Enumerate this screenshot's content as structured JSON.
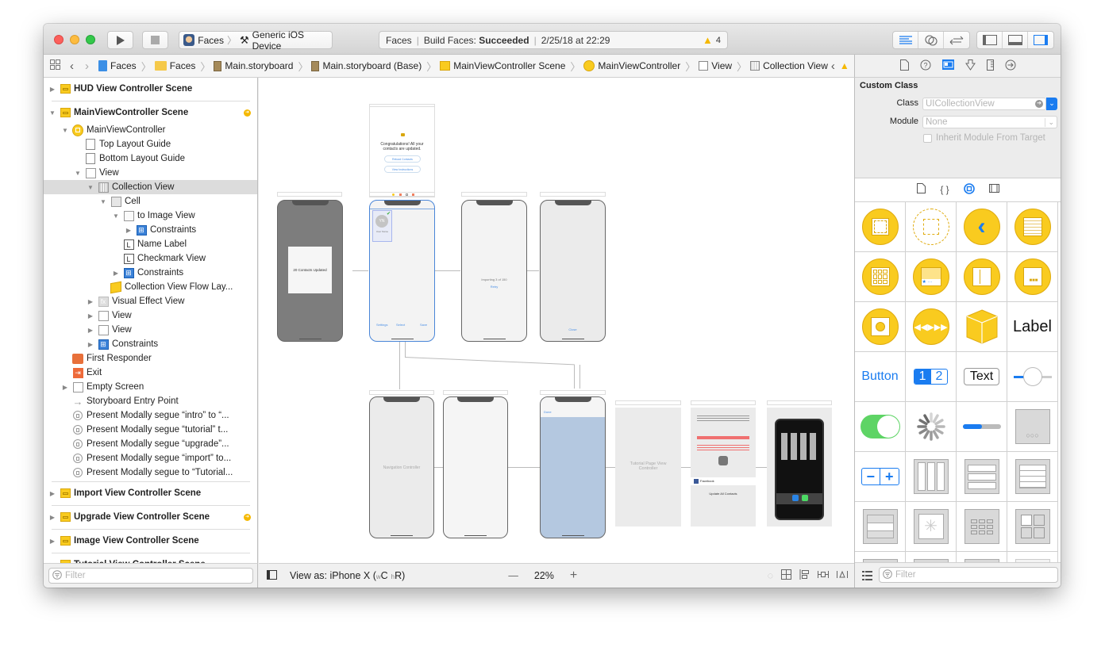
{
  "toolbar": {
    "scheme_target": "Faces",
    "scheme_device": "Generic iOS Device",
    "activity_project": "Faces",
    "activity_status_prefix": "Build Faces: ",
    "activity_status": "Succeeded",
    "activity_time": "2/25/18 at 22:29",
    "warnings_count": "4"
  },
  "jumpbar": {
    "crumbs": [
      "Faces",
      "Faces",
      "Main.storyboard",
      "Main.storyboard (Base)",
      "MainViewController Scene",
      "MainViewController",
      "View",
      "Collection View"
    ]
  },
  "outline": {
    "rows": [
      {
        "label": "HUD View Controller Scene",
        "icon": "scene-icon"
      },
      {
        "label": "MainViewController Scene",
        "icon": "scene-icon"
      },
      {
        "label": "MainViewController",
        "icon": "view-controller-icon"
      },
      {
        "label": "Top Layout Guide",
        "icon": "layout-guide-icon"
      },
      {
        "label": "Bottom Layout Guide",
        "icon": "layout-guide-icon"
      },
      {
        "label": "View",
        "icon": "view-icon"
      },
      {
        "label": "Collection View",
        "icon": "collection-view-icon"
      },
      {
        "label": "Cell",
        "icon": "cell-icon"
      },
      {
        "label": "to Image View",
        "icon": "image-view-icon"
      },
      {
        "label": "Constraints",
        "icon": "constraints-icon"
      },
      {
        "label": "Name Label",
        "icon": "label-icon"
      },
      {
        "label": "Checkmark View",
        "icon": "label-icon"
      },
      {
        "label": "Constraints",
        "icon": "constraints-icon"
      },
      {
        "label": "Collection View Flow Lay...",
        "icon": "flow-layout-icon"
      },
      {
        "label": "Visual Effect View",
        "icon": "visual-effect-icon"
      },
      {
        "label": "View",
        "icon": "view-icon"
      },
      {
        "label": "View",
        "icon": "view-icon"
      },
      {
        "label": "Constraints",
        "icon": "constraints-icon"
      },
      {
        "label": "First Responder",
        "icon": "first-responder-icon"
      },
      {
        "label": "Exit",
        "icon": "exit-icon"
      },
      {
        "label": "Empty Screen",
        "icon": "view-icon"
      },
      {
        "label": "Storyboard Entry Point",
        "icon": "entry-arrow-icon"
      },
      {
        "label": "Present Modally segue “intro” to “...",
        "icon": "segue-icon"
      },
      {
        "label": "Present Modally segue “tutorial” t...",
        "icon": "segue-icon"
      },
      {
        "label": "Present Modally segue “upgrade”...",
        "icon": "segue-icon"
      },
      {
        "label": "Present Modally segue “import” to...",
        "icon": "segue-icon"
      },
      {
        "label": "Present Modally segue to “Tutorial...",
        "icon": "segue-icon"
      },
      {
        "label": "Import View Controller Scene",
        "icon": "scene-icon"
      },
      {
        "label": "Upgrade View Controller Scene",
        "icon": "scene-icon"
      },
      {
        "label": "Image View Controller Scene",
        "icon": "scene-icon"
      },
      {
        "label": "Tutorial View Controller Scene",
        "icon": "scene-icon"
      }
    ],
    "filter_placeholder": "Filter"
  },
  "canvas": {
    "scenes": {
      "empty_screen_text": "Congratulations! All your contacts are updated.",
      "empty_btn1": "Reload Contacts",
      "empty_btn2": "View Instructions",
      "hud_text": "20 Contacts Updated",
      "cell_initials": "YN",
      "cell_name": "User Name",
      "main_toolbar": [
        "Settings",
        "Select",
        "Save"
      ],
      "import_text": "Importing 3 of 150",
      "import_link": "Retry",
      "upgrade_link": "Close",
      "nav_controller": "Navigation Controller",
      "tutorial_done": "Done",
      "tutorial_page": "Tutorial Page View Controller",
      "facebook_row": "Facebook",
      "update_all": "Update All Contacts"
    },
    "view_as_label": "View as: iPhone X (",
    "size_class_w": "w",
    "size_class_wval": "C",
    "size_class_h": "h",
    "size_class_hval": "R)",
    "zoom_minus": "—",
    "zoom_level": "22%",
    "zoom_plus": "+"
  },
  "inspector": {
    "section_title": "Custom Class",
    "class_label": "Class",
    "class_placeholder": "UICollectionView",
    "module_label": "Module",
    "module_placeholder": "None",
    "inherit_label": "Inherit Module From Target",
    "inherit_checked": false
  },
  "library": {
    "items": [
      "View Controller",
      "Storyboard Reference",
      "Navigation Controller",
      "Table View Controller",
      "Collection View Controller",
      "Tab Bar Controller",
      "Split View Controller",
      "Page View Controller",
      "GLKit View Controller",
      "AVKit Player View Controller",
      "Object",
      "Label",
      "Button",
      "Segmented Control",
      "Text Field",
      "Slider",
      "Switch",
      "Activity Indicator View",
      "Progress View",
      "Page Control",
      "Stepper",
      "Horizontal Stack View",
      "Vertical Stack View",
      "Table View",
      "Table View Cell",
      "Image View",
      "Collection View",
      "Collection View Cell",
      "Collection Reusable View",
      "Text View",
      "Scroll View",
      "Date Picker"
    ],
    "label_text": "Label",
    "button_text": "Button",
    "seg_1": "1",
    "seg_2": "2",
    "textfield_text": "Text",
    "filter_placeholder": "Filter"
  },
  "colors": {
    "accent": "#1a7cf0",
    "warning": "#f5b800",
    "scene_yellow": "#f9cb1f",
    "switch_green": "#5ed465"
  }
}
